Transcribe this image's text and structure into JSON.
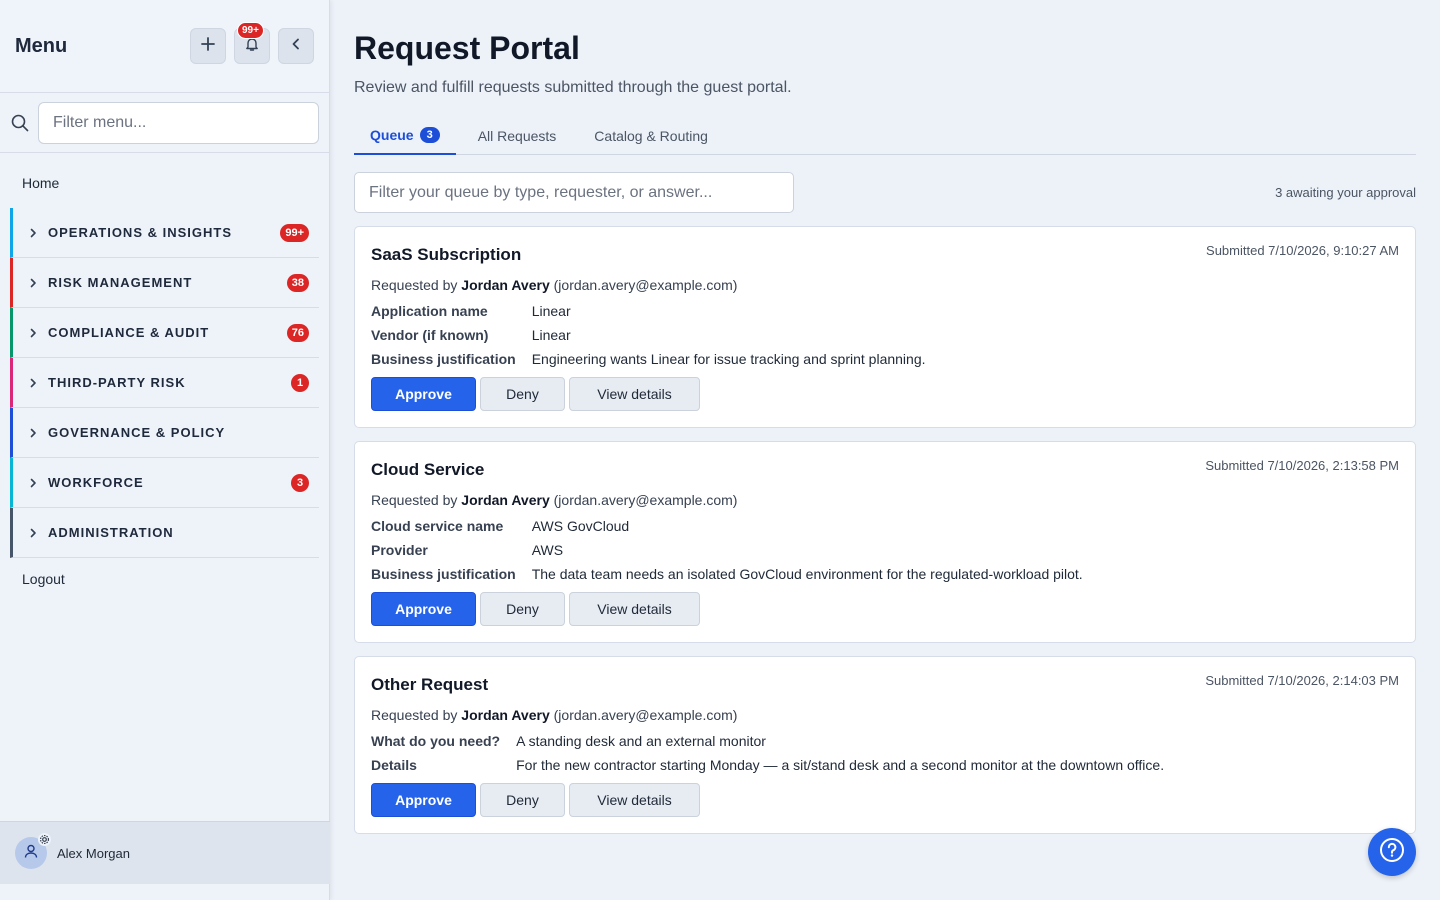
{
  "sidebar": {
    "title": "Menu",
    "notifications_badge": "99+",
    "filter_placeholder": "Filter menu...",
    "home": "Home",
    "groups": [
      {
        "label": "OPERATIONS & INSIGHTS",
        "badge": "99+",
        "color": "#0ea5e9"
      },
      {
        "label": "RISK MANAGEMENT",
        "badge": "38",
        "color": "#dc2626"
      },
      {
        "label": "COMPLIANCE & AUDIT",
        "badge": "76",
        "color": "#059669"
      },
      {
        "label": "THIRD-PARTY RISK",
        "badge": "1",
        "color": "#db2777"
      },
      {
        "label": "GOVERNANCE & POLICY",
        "badge": "",
        "color": "#1d4ed8"
      },
      {
        "label": "WORKFORCE",
        "badge": "3",
        "color": "#06b6d4"
      },
      {
        "label": "ADMINISTRATION",
        "badge": "",
        "color": "#475569"
      }
    ],
    "logout": "Logout",
    "user": {
      "name": "Alex Morgan"
    }
  },
  "main": {
    "title": "Request Portal",
    "subtitle": "Review and fulfill requests submitted through the guest portal.",
    "tabs": [
      {
        "label": "Queue",
        "badge": "3",
        "active": true
      },
      {
        "label": "All Requests"
      },
      {
        "label": "Catalog & Routing"
      }
    ],
    "queue_filter_placeholder": "Filter your queue by type, requester, or answer...",
    "awaiting_text": "3 awaiting your approval",
    "requested_by_prefix": "Requested by",
    "requests": [
      {
        "title": "SaaS Subscription",
        "submitted": "Submitted 7/10/2026, 9:10:27 AM",
        "requester_name": "Jordan Avery",
        "requester_email": "(jordan.avery@example.com)",
        "fields": [
          {
            "label": "Application name",
            "value": "Linear"
          },
          {
            "label": "Vendor (if known)",
            "value": "Linear"
          },
          {
            "label": "Business justification",
            "value": "Engineering wants Linear for issue tracking and sprint planning."
          }
        ]
      },
      {
        "title": "Cloud Service",
        "submitted": "Submitted 7/10/2026, 2:13:58 PM",
        "requester_name": "Jordan Avery",
        "requester_email": "(jordan.avery@example.com)",
        "fields": [
          {
            "label": "Cloud service name",
            "value": "AWS GovCloud"
          },
          {
            "label": "Provider",
            "value": "AWS"
          },
          {
            "label": "Business justification",
            "value": "The data team needs an isolated GovCloud environment for the regulated-workload pilot."
          }
        ]
      },
      {
        "title": "Other Request",
        "submitted": "Submitted 7/10/2026, 2:14:03 PM",
        "requester_name": "Jordan Avery",
        "requester_email": "(jordan.avery@example.com)",
        "fields": [
          {
            "label": "What do you need?",
            "value": "A standing desk and an external monitor"
          },
          {
            "label": "Details",
            "value": "For the new contractor starting Monday — a sit/stand desk and a second monitor at the downtown office."
          }
        ]
      }
    ],
    "actions": {
      "approve": "Approve",
      "deny": "Deny",
      "view": "View details"
    }
  },
  "icons": {
    "add": "plus-icon",
    "notifications": "bell-icon",
    "collapse": "chevron-left-icon",
    "search": "search-icon",
    "group_chevron": "chevron-right-icon",
    "user": "user-icon",
    "settings": "gear-icon",
    "help": "help-icon"
  }
}
